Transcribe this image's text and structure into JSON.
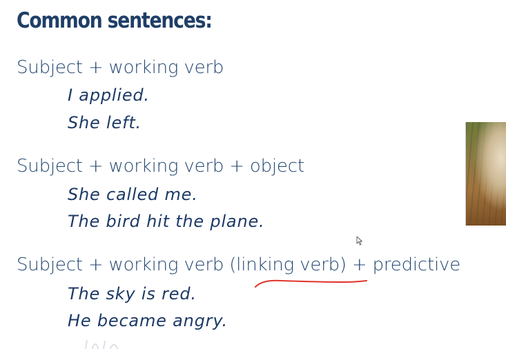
{
  "slide": {
    "title": "Common sentences:",
    "patterns": [
      {
        "label": "Subject + working verb",
        "examples": [
          "I applied.",
          "She left."
        ]
      },
      {
        "label": "Subject + working verb + object",
        "examples": [
          "She called me.",
          "The bird hit the plane."
        ]
      },
      {
        "label": "Subject + working verb (linking verb) + predictive",
        "examples": [
          "The sky is red.",
          "He became angry."
        ]
      }
    ]
  },
  "annotation": {
    "underline_color": "#e0332a"
  },
  "colors": {
    "title": "#1f3f68",
    "text": "#23466f",
    "handwriting": "#1d3a66"
  }
}
